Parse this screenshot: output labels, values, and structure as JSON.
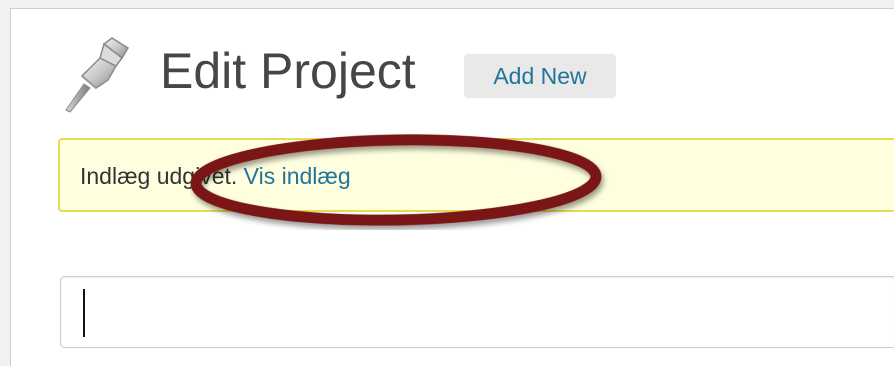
{
  "header": {
    "title": "Edit Project",
    "add_new_label": "Add New",
    "icon": "pushpin-icon"
  },
  "notice": {
    "text": "Indlæg udgivet.",
    "link_label": "Vis indlæg",
    "highlight_color": "#7a1414"
  },
  "title_field": {
    "value": ""
  },
  "colors": {
    "link": "#21759b",
    "notice_bg": "#ffffe0",
    "notice_border": "#e6db55",
    "title_text": "#464646"
  }
}
